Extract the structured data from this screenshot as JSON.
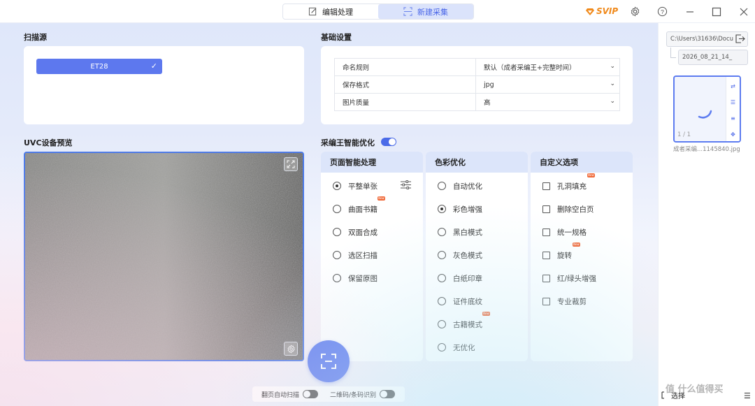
{
  "titlebar": {
    "tabs": [
      {
        "label": "编辑处理",
        "icon": "edit-icon",
        "active": false
      },
      {
        "label": "新建采集",
        "icon": "scan-icon",
        "active": true
      }
    ],
    "svip_label": "SVIP",
    "accent": "#4a66e8",
    "svip_color": "#f08a1c"
  },
  "scan_source": {
    "title": "扫描源",
    "device": "ET28",
    "device_selected": true
  },
  "basic_settings": {
    "title": "基础设置",
    "rows": [
      {
        "label": "命名规则",
        "value": "默认（成者采编王+完整时间）"
      },
      {
        "label": "保存格式",
        "value": "jpg"
      },
      {
        "label": "图片质量",
        "value": "高"
      }
    ]
  },
  "preview": {
    "title": "UVC设备预览"
  },
  "optimization": {
    "title": "采编王智能优化",
    "enabled": true,
    "columns": [
      {
        "header": "页面智能处理",
        "control": "radio",
        "options": [
          {
            "label": "平整单张",
            "selected": true,
            "has_settings": true,
            "new": false
          },
          {
            "label": "曲面书籍",
            "selected": false,
            "new": true
          },
          {
            "label": "双面合成",
            "selected": false,
            "new": false
          },
          {
            "label": "选区扫描",
            "selected": false,
            "new": false
          },
          {
            "label": "保留原图",
            "selected": false,
            "new": false
          }
        ]
      },
      {
        "header": "色彩优化",
        "control": "radio",
        "options": [
          {
            "label": "自动优化",
            "selected": false,
            "new": false
          },
          {
            "label": "彩色增强",
            "selected": true,
            "new": false
          },
          {
            "label": "黑白模式",
            "selected": false,
            "new": false
          },
          {
            "label": "灰色模式",
            "selected": false,
            "new": false
          },
          {
            "label": "白纸印章",
            "selected": false,
            "new": false
          },
          {
            "label": "证件底纹",
            "selected": false,
            "new": false
          },
          {
            "label": "古籍模式",
            "selected": false,
            "new": true
          },
          {
            "label": "无优化",
            "selected": false,
            "new": false
          }
        ]
      },
      {
        "header": "自定义选项",
        "control": "checkbox",
        "options": [
          {
            "label": "孔洞填充",
            "selected": false,
            "new": true
          },
          {
            "label": "删除空白页",
            "selected": false,
            "new": false
          },
          {
            "label": "统一规格",
            "selected": false,
            "new": false
          },
          {
            "label": "旋转",
            "selected": false,
            "new": true
          },
          {
            "label": "红/绿头增强",
            "selected": false,
            "new": false
          },
          {
            "label": "专业裁剪",
            "selected": false,
            "new": false
          }
        ]
      }
    ]
  },
  "bottom": {
    "auto_scan_label": "翻页自动扫描",
    "auto_scan_on": false,
    "qr_label": "二维码/条码识别",
    "qr_on": false
  },
  "right_panel": {
    "path": "C:\\Users\\31636\\Docu",
    "folder": "2026_08_21_14_",
    "thumb_page": "1 / 1",
    "thumb_name": "成者采编...1145840.jpg",
    "select_label": "选择",
    "watermark": "值 什么值得买"
  }
}
